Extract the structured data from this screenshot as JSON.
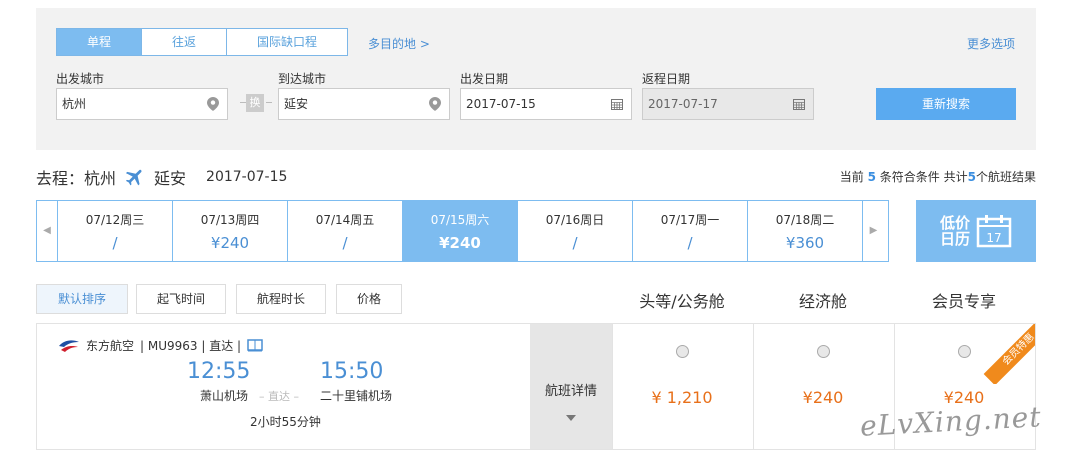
{
  "search": {
    "tabs": [
      "单程",
      "往返",
      "国际缺口程"
    ],
    "multi_dest": "多目的地 >",
    "more_options": "更多选项",
    "depart_city_label": "出发城市",
    "depart_city": "杭州",
    "swap_label": "换",
    "arrive_city_label": "到达城市",
    "arrive_city": "延安",
    "depart_date_label": "出发日期",
    "depart_date": "2017-07-15",
    "return_date_label": "返程日期",
    "return_date": "2017-07-17",
    "search_button": "重新搜索"
  },
  "route": {
    "prefix": "去程：杭州",
    "to": "延安",
    "date": "2017-07-15"
  },
  "summary": {
    "pre": "当前 ",
    "count": "5",
    "mid": " 条符合条件 共计",
    "total": "5",
    "post": "个航班结果"
  },
  "datebar": [
    {
      "date": "07/12周三",
      "price": "/"
    },
    {
      "date": "07/13周四",
      "price": "¥240"
    },
    {
      "date": "07/14周五",
      "price": "/"
    },
    {
      "date": "07/15周六",
      "price": "¥240"
    },
    {
      "date": "07/16周日",
      "price": "/"
    },
    {
      "date": "07/17周一",
      "price": "/"
    },
    {
      "date": "07/18周二",
      "price": "¥360"
    }
  ],
  "lowcal": {
    "line1": "低价",
    "line2": "日历",
    "day": "17"
  },
  "sort": [
    "默认排序",
    "起飞时间",
    "航程时长",
    "价格"
  ],
  "columns": [
    "头等/公务舱",
    "经济舱",
    "会员专享"
  ],
  "flight": {
    "airline": "东方航空",
    "info": "| MU9963 | 直达 |",
    "dep_time": "12:55",
    "arr_time": "15:50",
    "dep_airport": "萧山机场",
    "direct": "– 直达 –",
    "arr_airport": "二十里铺机场",
    "duration": "2小时55分钟",
    "detail_label": "航班详情",
    "prices": [
      "¥ 1,210",
      "¥240",
      "¥240"
    ],
    "ribbon": "会员特惠"
  },
  "watermark": "eLvXing.net",
  "colors": {
    "accent": "#7dbcf0",
    "price": "#e8701a",
    "link": "#4a8fd4"
  }
}
